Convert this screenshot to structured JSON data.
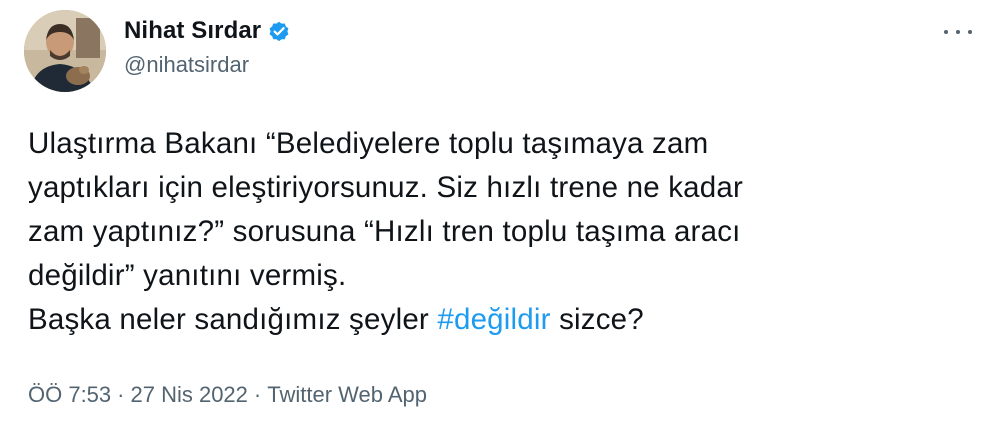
{
  "author": {
    "display_name": "Nihat Sırdar",
    "handle": "@nihatsirdar",
    "verified": true
  },
  "icons": {
    "verified": "verified-badge-icon",
    "more": "more-options-icon"
  },
  "colors": {
    "accent": "#1d9bf0",
    "text": "#0f1419",
    "muted": "#536471"
  },
  "tweet": {
    "lines": [
      "Ulaştırma Bakanı “Belediyelere toplu taşımaya zam",
      "yaptıkları için eleştiriyorsunuz. Siz hızlı trene ne kadar",
      "zam yaptınız?” sorusuna “Hızlı tren toplu taşıma aracı",
      "değildir” yanıtını vermiş."
    ],
    "last_line_prefix": "Başka neler sandığımız şeyler ",
    "hashtag": "#değildir",
    "last_line_suffix": " sizce?"
  },
  "meta": {
    "time": "ÖÖ 7:53",
    "separator": "·",
    "date": "27 Nis 2022",
    "source": "Twitter Web App"
  }
}
